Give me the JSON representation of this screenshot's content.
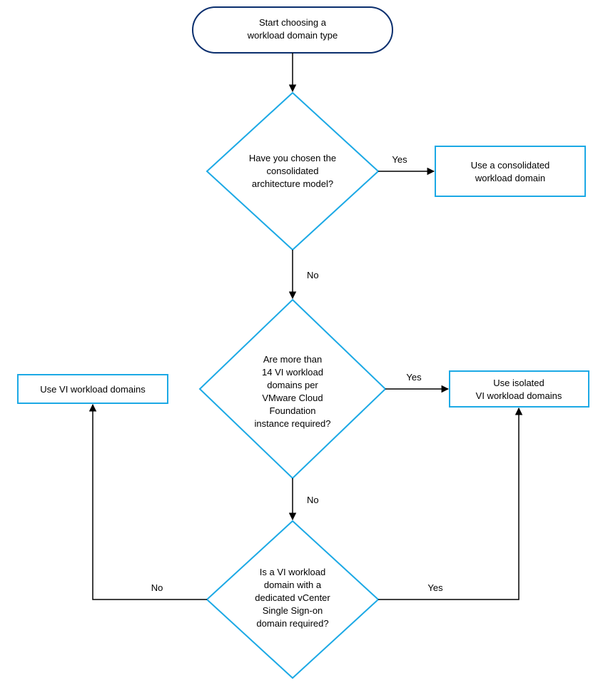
{
  "chart_data": {
    "type": "flowchart",
    "nodes": [
      {
        "id": "start",
        "shape": "terminator",
        "lines": [
          "Start choosing a",
          "workload domain type"
        ]
      },
      {
        "id": "d1",
        "shape": "decision",
        "lines": [
          "Have you chosen the",
          "consolidated",
          "architecture model?"
        ]
      },
      {
        "id": "r1",
        "shape": "process",
        "lines": [
          "Use a consolidated",
          "workload domain"
        ]
      },
      {
        "id": "d2",
        "shape": "decision",
        "lines": [
          "Are more than",
          "14 VI workload",
          "domains per",
          "VMware Cloud",
          "Foundation",
          "instance required?"
        ]
      },
      {
        "id": "r2left",
        "shape": "process",
        "lines": [
          "Use VI workload domains"
        ]
      },
      {
        "id": "r2right",
        "shape": "process",
        "lines": [
          "Use isolated",
          "VI workload domains"
        ]
      },
      {
        "id": "d3",
        "shape": "decision",
        "lines": [
          "Is a VI workload",
          "domain with a",
          "dedicated vCenter",
          "Single Sign-on",
          "domain required?"
        ]
      }
    ],
    "edges": [
      {
        "from": "start",
        "to": "d1",
        "label": ""
      },
      {
        "from": "d1",
        "to": "r1",
        "label": "Yes"
      },
      {
        "from": "d1",
        "to": "d2",
        "label": "No"
      },
      {
        "from": "d2",
        "to": "r2right",
        "label": "Yes"
      },
      {
        "from": "d2",
        "to": "d3",
        "label": "No"
      },
      {
        "from": "d3",
        "to": "r2left",
        "label": "No"
      },
      {
        "from": "d3",
        "to": "r2right",
        "label": "Yes"
      }
    ],
    "labels": {
      "yes": "Yes",
      "no": "No"
    },
    "colors": {
      "decision_stroke": "#1CA9E5",
      "process_stroke": "#1CA9E5",
      "start_stroke": "#0B2F6E",
      "edge": "#000000"
    }
  }
}
